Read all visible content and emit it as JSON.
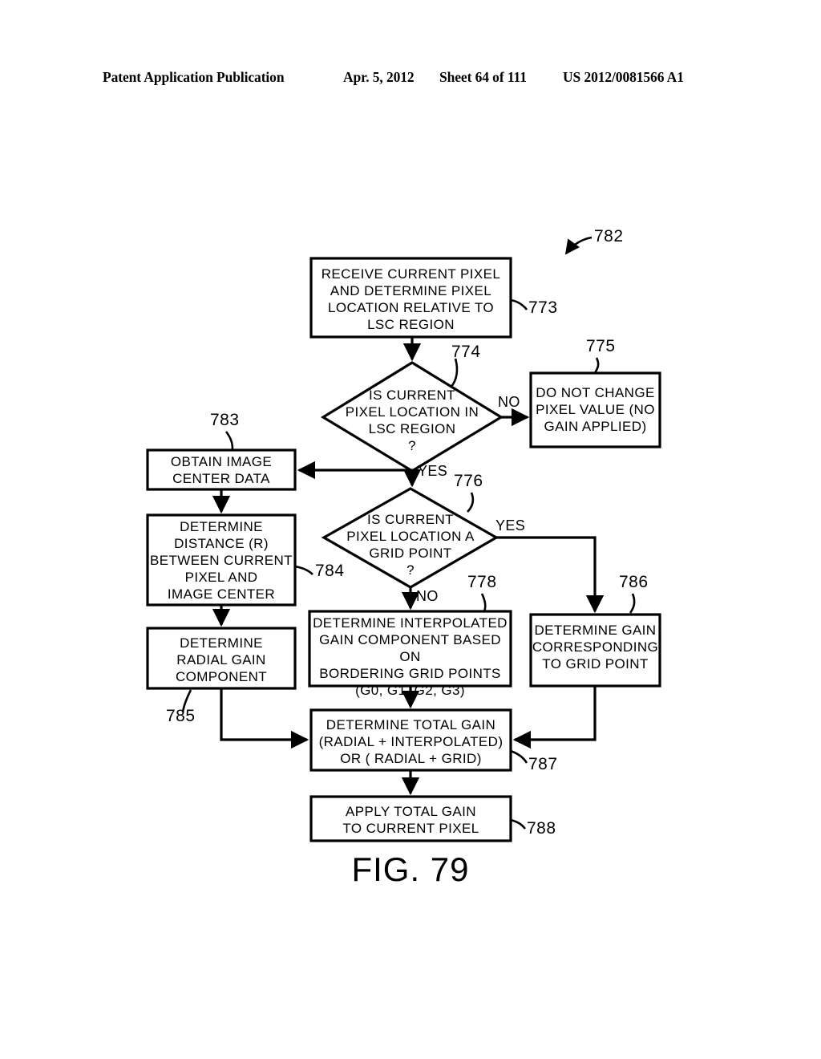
{
  "header": {
    "publication": "Patent Application Publication",
    "date": "Apr. 5, 2012",
    "sheet": "Sheet 64 of 111",
    "patent_number": "US 2012/0081566 A1"
  },
  "figure": {
    "caption": "FIG. 79",
    "diagram_label": "782"
  },
  "nodes": {
    "receive_pixel": {
      "text": "RECEIVE  CURRENT  PIXEL\nAND  DETERMINE  PIXEL\nLOCATION  RELATIVE  TO\nLSC  REGION",
      "ref": "773"
    },
    "in_lsc_region": {
      "text": "IS  CURRENT\nPIXEL  LOCATION   IN\nLSC  REGION\n?",
      "ref": "774"
    },
    "no_change": {
      "text": "DO  NOT  CHANGE\nPIXEL VALUE (NO\nGAIN  APPLIED)",
      "ref": "775"
    },
    "obtain_center": {
      "text": "OBTAIN  IMAGE\nCENTER  DATA",
      "ref": "783"
    },
    "is_grid_point": {
      "text": "IS  CURRENT\nPIXEL  LOCATION   A\nGRID  POINT\n?",
      "ref": "776"
    },
    "determine_distance": {
      "text": "DETERMINE\nDISTANCE (R)\nBETWEEN  CURRENT\nPIXEL AND\nIMAGE  CENTER",
      "ref": "784"
    },
    "interpolated_gain": {
      "text": "DETERMINE INTERPOLATED\nGAIN COMPONENT BASED ON\nBORDERING GRID POINTS\n(G0, G1, G2, G3)",
      "ref": "778"
    },
    "grid_point_gain": {
      "text": "DETERMINE GAIN\nCORRESPONDING\nTO GRID  POINT",
      "ref": "786"
    },
    "radial_gain": {
      "text": "DETERMINE\nRADIAL GAIN\nCOMPONENT",
      "ref": "785"
    },
    "total_gain": {
      "text": "DETERMINE  TOTAL  GAIN\n(RADIAL + INTERPOLATED)\nOR  ( RADIAL + GRID)",
      "ref": "787"
    },
    "apply_gain": {
      "text": "APPLY  TOTAL  GAIN\nTO  CURRENT  PIXEL",
      "ref": "788"
    }
  },
  "edge_labels": {
    "lsc_no": "NO",
    "lsc_yes": "YES",
    "grid_yes": "YES",
    "grid_no": "NO"
  },
  "colors": {
    "ink": "#000000",
    "paper": "#ffffff"
  }
}
